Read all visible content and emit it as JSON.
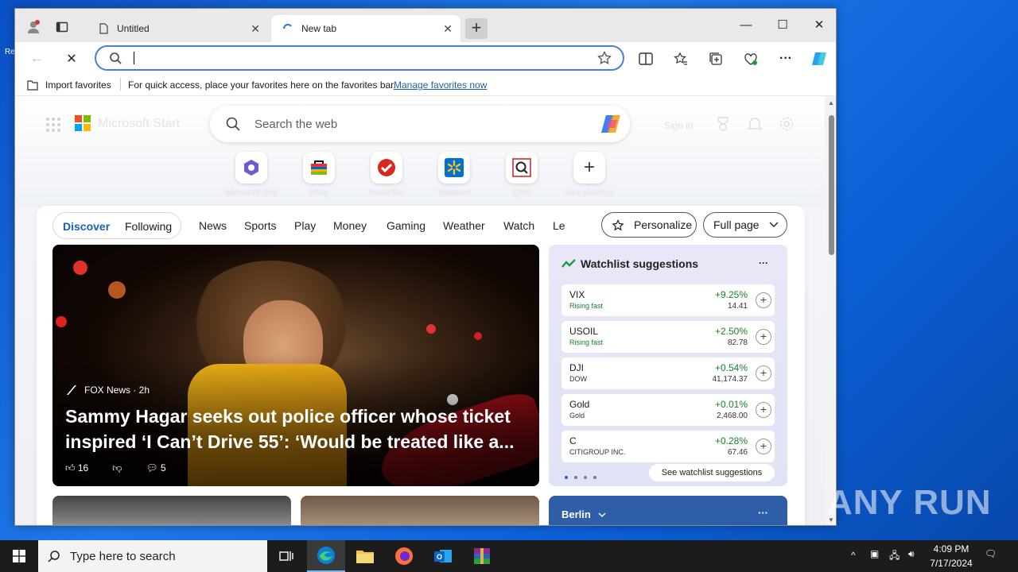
{
  "browser": {
    "tabs": [
      {
        "label": "Untitled"
      },
      {
        "label": "New tab"
      }
    ],
    "address": {
      "value": "",
      "placeholder": ""
    },
    "favorites_bar": {
      "import_label": "Import favorites",
      "message": "For quick access, place your favorites here on the favorites bar.",
      "manage_link": "Manage favorites now"
    }
  },
  "newtab": {
    "brand": "Microsoft Start",
    "search_placeholder": "Search the web",
    "signin": "Sign in",
    "shortcuts": [
      {
        "label": "Microsoft 365"
      },
      {
        "label": "eBay"
      },
      {
        "label": "TurboTax"
      },
      {
        "label": "Walmart"
      },
      {
        "label": "QVC"
      },
      {
        "label": "Add shortcut"
      }
    ],
    "feed_tabs": {
      "discover": "Discover",
      "following": "Following",
      "items": [
        "News",
        "Sports",
        "Play",
        "Money",
        "Gaming",
        "Weather",
        "Watch",
        "Le"
      ]
    },
    "personalize": "Personalize",
    "full_page": "Full page",
    "hero": {
      "source": "FOX News · 2h",
      "headline": "Sammy Hagar seeks out police officer whose ticket inspired ‘I Can’t Drive 55’: ‘Would be treated like a...",
      "likes": "16",
      "comments": "5"
    },
    "watchlist": {
      "title": "Watchlist suggestions",
      "rows": [
        {
          "symbol": "VIX",
          "sub": "Rising fast",
          "pct": "+9.25%",
          "value": "14.41"
        },
        {
          "symbol": "USOIL",
          "sub": "Rising fast",
          "pct": "+2.50%",
          "value": "82.78"
        },
        {
          "symbol": "DJI",
          "sub": "DOW",
          "pct": "+0.54%",
          "value": "41,174.37"
        },
        {
          "symbol": "Gold",
          "sub": "Gold",
          "pct": "+0.01%",
          "value": "2,468.00"
        },
        {
          "symbol": "C",
          "sub": "CITIGROUP INC.",
          "pct": "+0.28%",
          "value": "67.46"
        }
      ],
      "see_more": "See watchlist suggestions"
    },
    "weather_card": {
      "city": "Berlin"
    }
  },
  "taskbar": {
    "search_placeholder": "Type here to search",
    "time": "4:09 PM",
    "date": "7/17/2024"
  },
  "watermark": "ANY RUN"
}
